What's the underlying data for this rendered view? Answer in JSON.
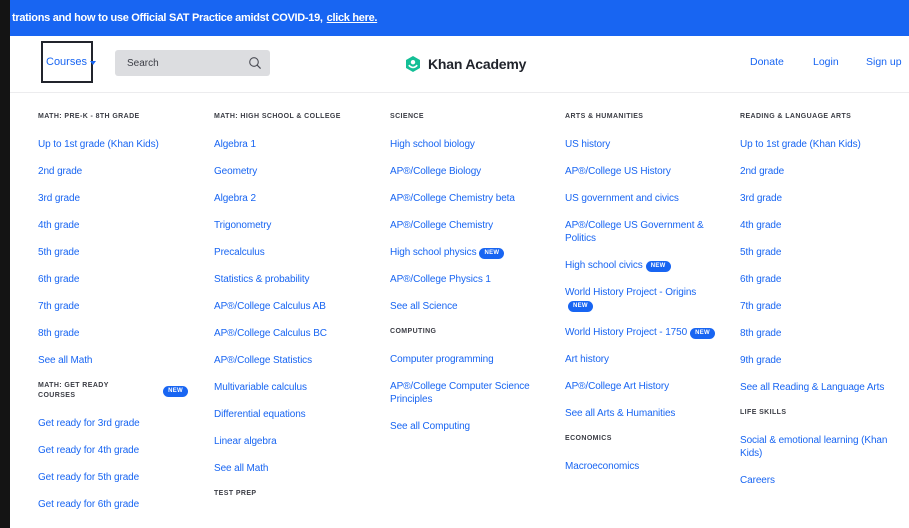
{
  "banner": {
    "text": "trations and how to use Official SAT Practice amidst COVID-19,",
    "link": "click here."
  },
  "header": {
    "courses_label": "Courses",
    "search_placeholder": "Search",
    "brand": "Khan Academy",
    "donate": "Donate",
    "login": "Login",
    "signup": "Sign up"
  },
  "badge_new": "NEW",
  "columns": {
    "math_prek": {
      "heading": "MATH: PRE-K - 8TH GRADE",
      "items": [
        "Up to 1st grade (Khan Kids)",
        "2nd grade",
        "3rd grade",
        "4th grade",
        "5th grade",
        "6th grade",
        "7th grade",
        "8th grade",
        "See all Math"
      ],
      "heading2": "MATH: GET READY COURSES",
      "items2": [
        "Get ready for 3rd grade",
        "Get ready for 4th grade",
        "Get ready for 5th grade",
        "Get ready for 6th grade"
      ]
    },
    "math_hs": {
      "heading": "MATH: HIGH SCHOOL & COLLEGE",
      "items": [
        "Algebra 1",
        "Geometry",
        "Algebra 2",
        "Trigonometry",
        "Precalculus",
        "Statistics & probability",
        "AP®/College Calculus AB",
        "AP®/College Calculus BC",
        "AP®/College Statistics",
        "Multivariable calculus",
        "Differential equations",
        "Linear algebra",
        "See all Math"
      ],
      "heading2": "TEST PREP"
    },
    "science": {
      "heading": "SCIENCE",
      "items": [
        "High school biology",
        "AP®/College Biology",
        "AP®/College Chemistry beta",
        "AP®/College Chemistry",
        "High school physics",
        "AP®/College Physics 1",
        "See all Science"
      ],
      "heading2": "COMPUTING",
      "items2": [
        "Computer programming",
        "AP®/College Computer Science Principles",
        "See all Computing"
      ]
    },
    "arts": {
      "heading": "ARTS & HUMANITIES",
      "items": [
        "US history",
        "AP®/College US History",
        "US government and civics",
        "AP®/College US Government & Politics",
        "High school civics",
        "World History Project - Origins",
        "World History Project - 1750",
        "Art history",
        "AP®/College Art History",
        "See all Arts & Humanities"
      ],
      "heading2": "ECONOMICS",
      "items2": [
        "Macroeconomics"
      ]
    },
    "reading": {
      "heading": "READING & LANGUAGE ARTS",
      "items": [
        "Up to 1st grade (Khan Kids)",
        "2nd grade",
        "3rd grade",
        "4th grade",
        "5th grade",
        "6th grade",
        "7th grade",
        "8th grade",
        "9th grade",
        "See all Reading & Language Arts"
      ],
      "heading2": "LIFE SKILLS",
      "items2": [
        "Social & emotional learning (Khan Kids)",
        "Careers"
      ]
    }
  }
}
